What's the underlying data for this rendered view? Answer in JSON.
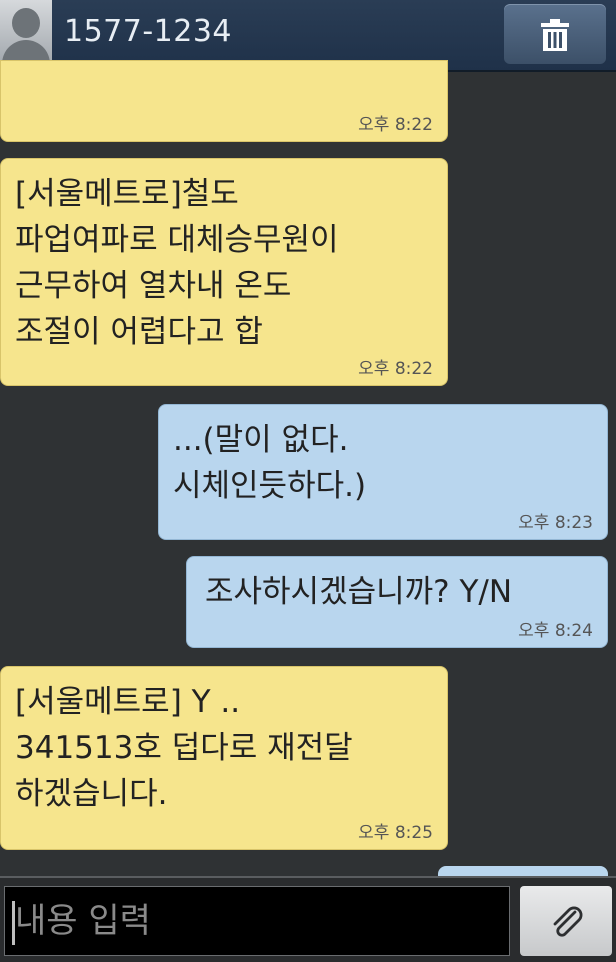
{
  "header": {
    "contact_number": "1577-1234",
    "delete_icon": "trash-icon",
    "avatar_icon": "person-silhouette-icon"
  },
  "messages": [
    {
      "side": "in",
      "lines": [],
      "time": "오후 8:22"
    },
    {
      "side": "in",
      "lines": [
        "[서울메트로]철도",
        "파업여파로 대체승무원이",
        "근무하여 열차내 온도",
        "조절이 어렵다고 합"
      ],
      "time": "오후 8:22"
    },
    {
      "side": "out",
      "lines": [
        "...(말이 없다.",
        "시체인듯하다.)"
      ],
      "time": "오후 8:23"
    },
    {
      "side": "out",
      "lines": [
        "조사하시겠습니까?  Y/N"
      ],
      "time": "오후 8:24"
    },
    {
      "side": "in",
      "lines": [
        "[서울메트로] Y ..",
        "341513호 덥다로 재전달",
        "하겠습니다."
      ],
      "time": "오후 8:25"
    }
  ],
  "composer": {
    "placeholder": "내용 입력",
    "attach_icon": "paperclip-icon"
  },
  "colors": {
    "incoming_bubble": "#f6e58d",
    "outgoing_bubble": "#b9d6ee",
    "background": "#2f3234",
    "header": "#22354d"
  }
}
